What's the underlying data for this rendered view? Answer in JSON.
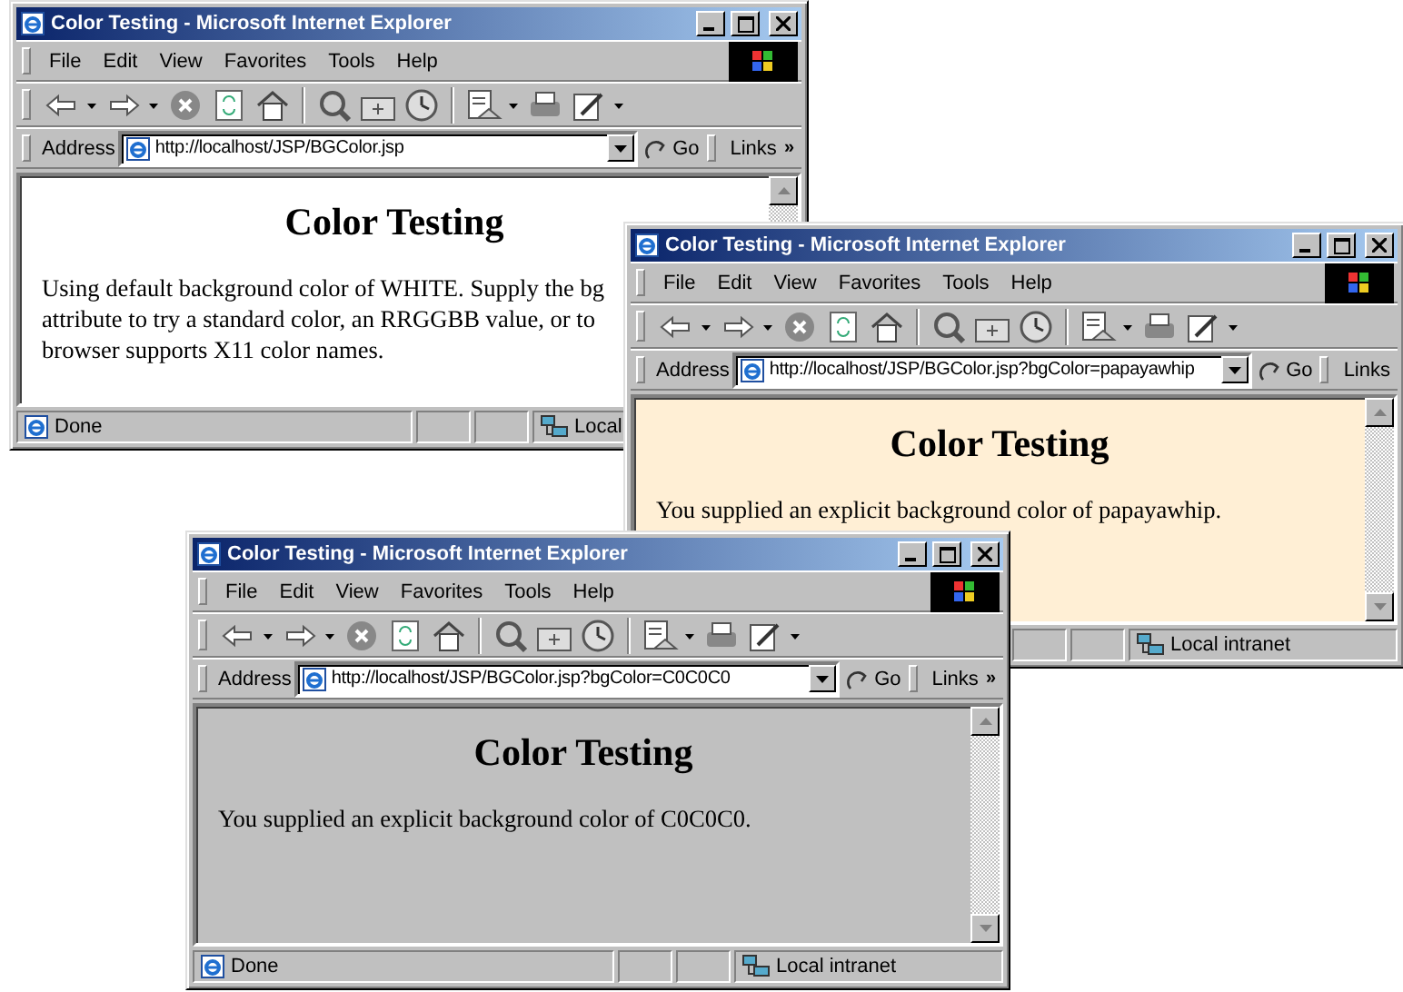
{
  "windows": [
    {
      "title": "Color Testing - Microsoft Internet Explorer",
      "menu": [
        "File",
        "Edit",
        "View",
        "Favorites",
        "Tools",
        "Help"
      ],
      "address_label": "Address",
      "url": "http://localhost/JSP/BGColor.jsp",
      "go": "Go",
      "links": "Links",
      "links_more": "»",
      "color": "#ffffff",
      "heading": "Color Testing",
      "paragraph": [
        "Using default background color of WHITE. Supply the bg",
        "attribute to try a standard color, an RRGGBB value, or to",
        "browser supports X11 color names."
      ],
      "status": "Done",
      "zone": "Local"
    },
    {
      "title": "Color Testing - Microsoft Internet Explorer",
      "menu": [
        "File",
        "Edit",
        "View",
        "Favorites",
        "Tools",
        "Help"
      ],
      "address_label": "Address",
      "url": "http://localhost/JSP/BGColor.jsp?bgColor=papayawhip",
      "go": "Go",
      "links": "Links",
      "color": "#ffefd5",
      "heading": "Color Testing",
      "paragraph": [
        "You supplied an explicit background color of papayawhip."
      ],
      "zone": "Local intranet"
    },
    {
      "title": "Color Testing - Microsoft Internet Explorer",
      "menu": [
        "File",
        "Edit",
        "View",
        "Favorites",
        "Tools",
        "Help"
      ],
      "address_label": "Address",
      "url": "http://localhost/JSP/BGColor.jsp?bgColor=C0C0C0",
      "go": "Go",
      "links": "Links",
      "links_more": "»",
      "color": "#c0c0c0",
      "heading": "Color Testing",
      "paragraph": [
        "You supplied an explicit background color of C0C0C0."
      ],
      "status": "Done",
      "zone": "Local intranet"
    }
  ]
}
